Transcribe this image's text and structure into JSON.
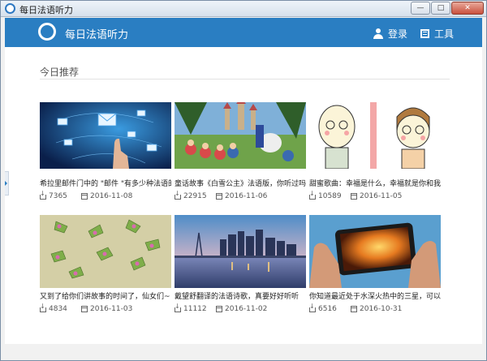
{
  "window": {
    "title": "每日法语听力",
    "minimize_glyph": "—",
    "maximize_glyph": "□",
    "close_glyph": "✕"
  },
  "appbar": {
    "title": "每日法语听力",
    "login_label": "登录",
    "tools_label": "工具"
  },
  "section": {
    "title": "今日推荐"
  },
  "cards": [
    {
      "title": "希拉里邮件门中的 \"邮件 \"有多少种法语的表达...",
      "downloads": "7365",
      "date": "2016-11-08"
    },
    {
      "title": "童话故事《白雪公主》法语版，你听过吗？",
      "downloads": "22915",
      "date": "2016-11-06"
    },
    {
      "title": "甜蜜歌曲：幸福是什么，幸福就是你和我，白...",
      "downloads": "10589",
      "date": "2016-11-05"
    },
    {
      "title": "又到了给你们讲故事的时间了，仙女们~",
      "downloads": "4834",
      "date": "2016-11-03"
    },
    {
      "title": "戴望舒翻译的法语诗歌，真要好好听听",
      "downloads": "11112",
      "date": "2016-11-02"
    },
    {
      "title": "你知道最近处于水深火热中的三星，可以用 \"...",
      "downloads": "6516",
      "date": "2016-10-31"
    }
  ],
  "icons": [
    "app-logo-icon",
    "user-icon",
    "tools-icon",
    "download-icon",
    "calendar-icon"
  ],
  "colors": {
    "brand": "#2a7ec2"
  }
}
